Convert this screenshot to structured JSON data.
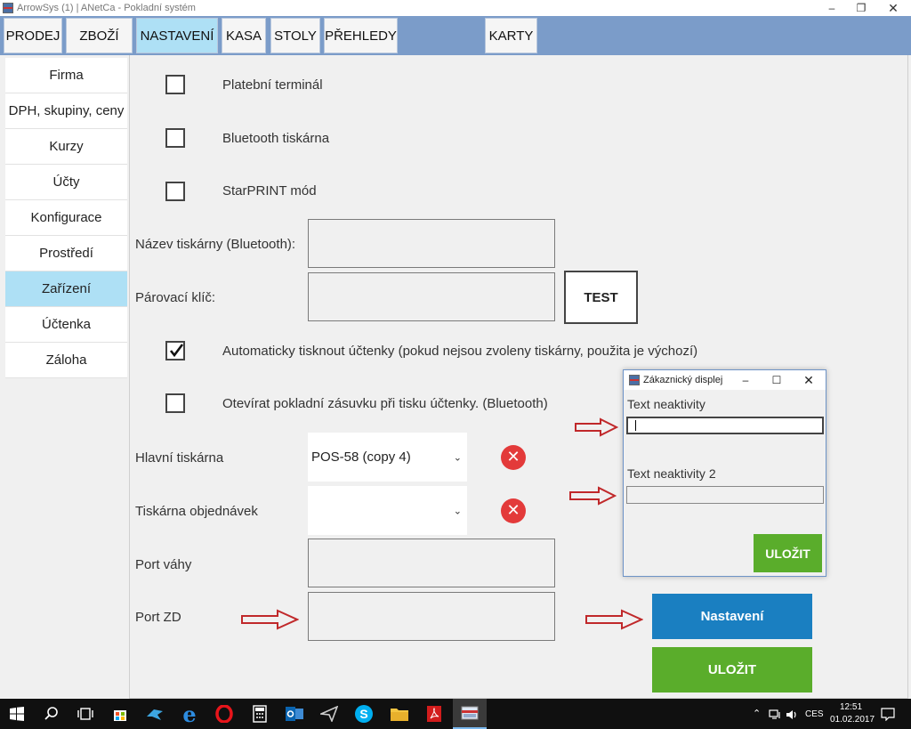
{
  "window": {
    "title": "ArrowSys (1) | ANetCa - Pokladní systém"
  },
  "menu": {
    "tabs": [
      {
        "label": "PRODEJ"
      },
      {
        "label": "ZBOŽÍ"
      },
      {
        "label": "NASTAVENÍ",
        "active": true
      },
      {
        "label": "KASA"
      },
      {
        "label": "STOLY"
      },
      {
        "label": "PŘEHLEDY"
      },
      {
        "label": "KARTY"
      }
    ]
  },
  "sidebar": {
    "items": [
      {
        "label": "Firma"
      },
      {
        "label": "DPH, skupiny, ceny"
      },
      {
        "label": "Kurzy"
      },
      {
        "label": "Účty"
      },
      {
        "label": "Konfigurace"
      },
      {
        "label": "Prostředí"
      },
      {
        "label": "Zařízení",
        "active": true
      },
      {
        "label": "Účtenka"
      },
      {
        "label": "Záloha"
      }
    ]
  },
  "settings": {
    "platebni_terminal": {
      "label": "Platební terminál",
      "checked": false
    },
    "bluetooth_tiskarna": {
      "label": "Bluetooth tiskárna",
      "checked": false
    },
    "starprint": {
      "label": "StarPRINT mód",
      "checked": false
    },
    "nazev_tiskarny": {
      "label": "Název tiskárny (Bluetooth):",
      "value": ""
    },
    "parovaci_klic": {
      "label": "Párovací klíč:",
      "value": ""
    },
    "test_button": "TEST",
    "auto_tisk": {
      "label": "Automaticky tisknout účtenky (pokud nejsou zvoleny tiskárny, použita je výchozí)",
      "checked": true
    },
    "otevirat_zasuvku": {
      "label": "Otevírat pokladní zásuvku při tisku účtenky. (Bluetooth)",
      "checked": false
    },
    "hlavni_tiskarna": {
      "label": "Hlavní tiskárna",
      "value": "POS-58 (copy 4)"
    },
    "tiskarna_objednavek": {
      "label": "Tiskárna objednávek",
      "value": ""
    },
    "port_vahy": {
      "label": "Port váhy",
      "value": ""
    },
    "port_zd": {
      "label": "Port ZD",
      "value": ""
    },
    "nastaveni_button": "Nastavení",
    "ulozit_button": "ULOŽIT"
  },
  "dialog": {
    "title": "Zákaznický displej",
    "text1_label": "Text neaktivity",
    "text1_value": "",
    "text2_label": "Text neaktivity 2",
    "text2_value": "",
    "save_button": "ULOŽIT"
  },
  "taskbar": {
    "language": "CES",
    "time": "12:51",
    "date": "01.02.2017"
  },
  "colors": {
    "menu_bar": "#7b9cc9",
    "active_tab": "#aee0f5",
    "nastaveni_button": "#1a7fc1",
    "ulozit_button": "#5aad2b",
    "remove_icon": "#e33a3a",
    "arrow": "#c0282a"
  }
}
